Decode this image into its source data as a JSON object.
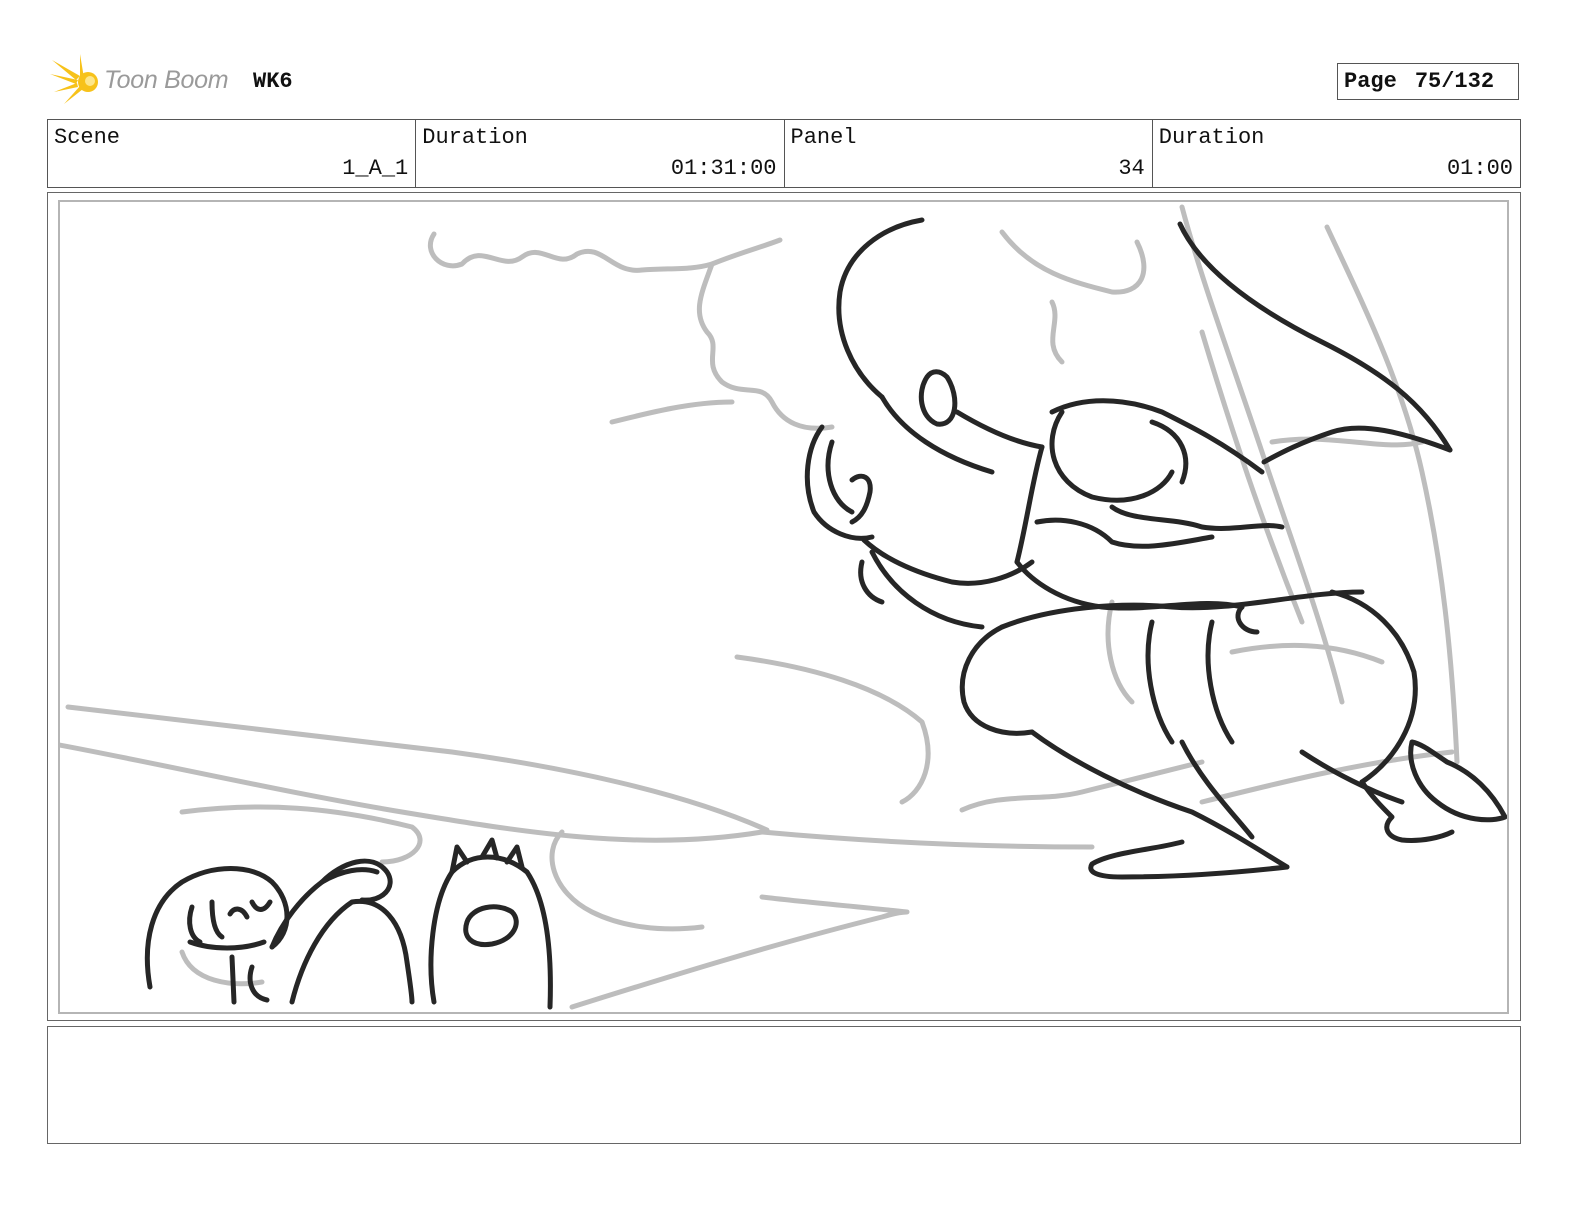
{
  "header": {
    "logo_text": "Toon Boom",
    "project": "WK6",
    "page_label": "Page",
    "page_number": "75/132"
  },
  "info": {
    "scene_label": "Scene",
    "scene_value": "1_A_1",
    "scene_duration_label": "Duration",
    "scene_duration_value": "01:31:00",
    "panel_label": "Panel",
    "panel_value": "34",
    "panel_duration_label": "Duration",
    "panel_duration_value": "01:00"
  },
  "panel": {
    "icon": "storyboard-sketch",
    "colors": {
      "rough": "#bdbdbd",
      "ink": "#262626",
      "logo_star": "#f7c21a"
    }
  },
  "notes": {
    "text": ""
  }
}
